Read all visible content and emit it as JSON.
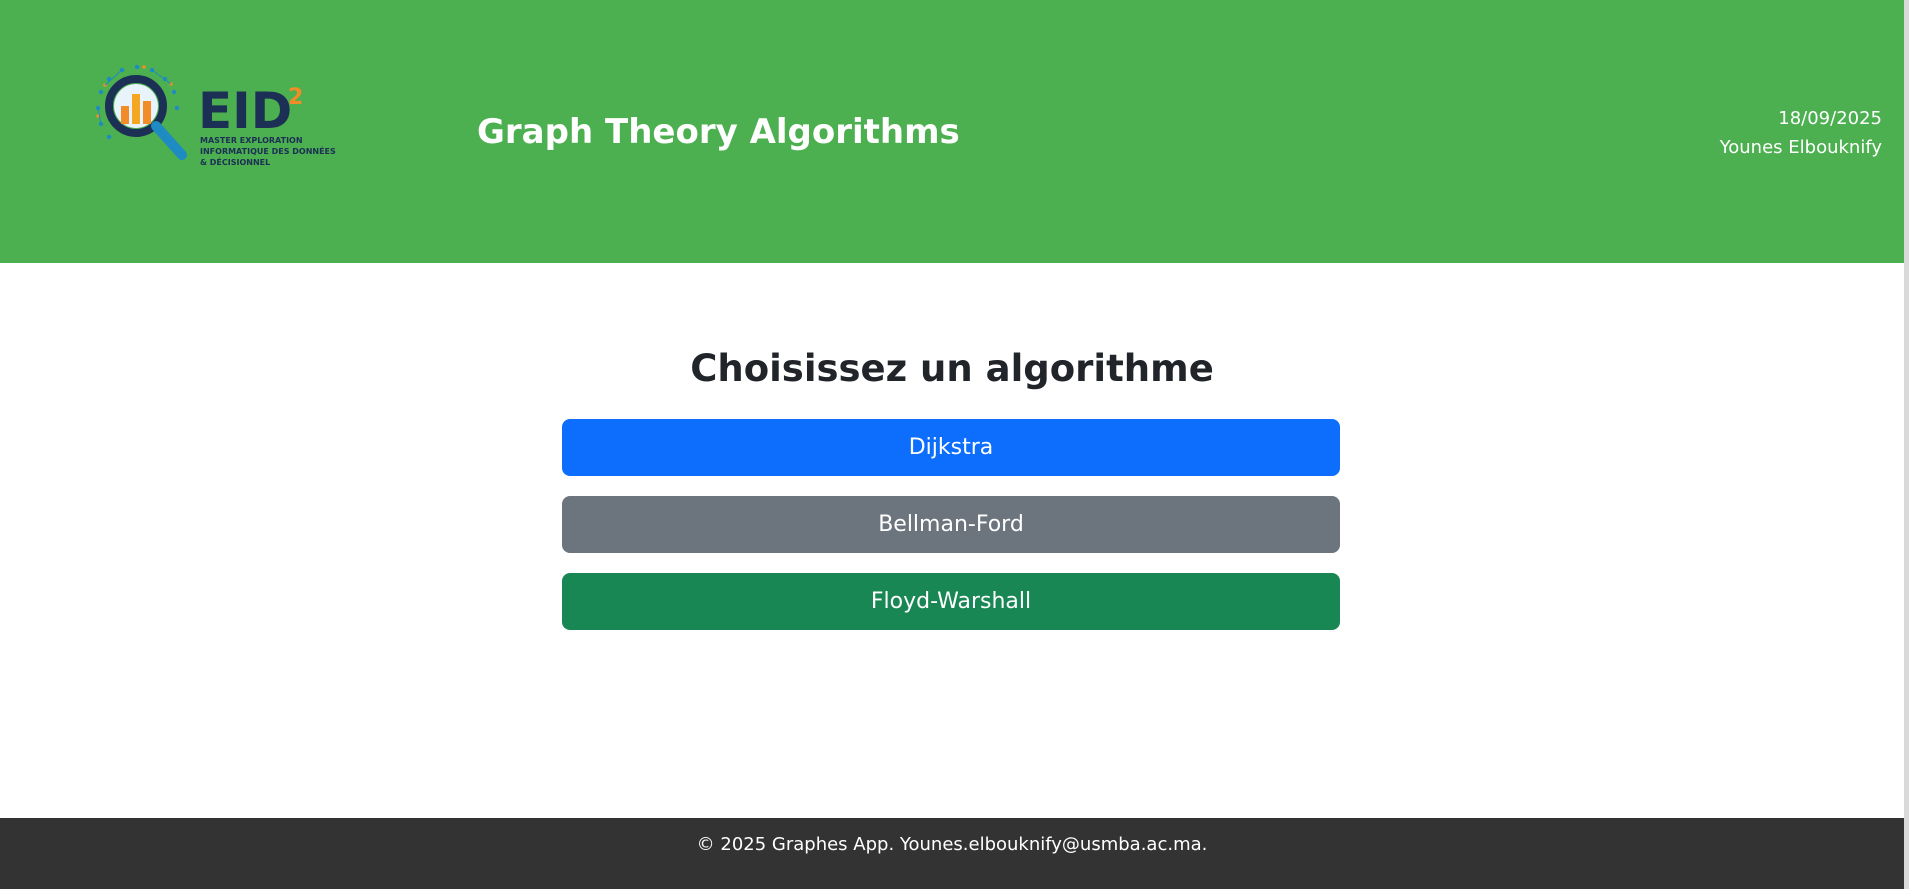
{
  "header": {
    "logo": {
      "wordmark": "EID",
      "superscript": "2",
      "tagline_lines": [
        "MASTER EXPLORATION",
        "INFORMATIQUE DES DONNÉES",
        "& DÉCISIONNEL"
      ],
      "icon": "magnifier-chart-icon",
      "colors": {
        "navy": "#1c2f54",
        "orange": "#f28c28",
        "blue": "#1e8bc3"
      }
    },
    "title": "Graph Theory Algorithms",
    "date": "18/09/2025",
    "author": "Younes Elbouknify",
    "background": "#4cb050"
  },
  "main": {
    "heading": "Choisissez un algorithme",
    "algorithms": [
      {
        "label": "Dijkstra",
        "color": "#0d6efd"
      },
      {
        "label": "Bellman-Ford",
        "color": "#6c757d"
      },
      {
        "label": "Floyd-Warshall",
        "color": "#198754"
      }
    ]
  },
  "footer": {
    "text": "© 2025 Graphes App. Younes.elbouknify@usmba.ac.ma.",
    "background": "#333333"
  }
}
